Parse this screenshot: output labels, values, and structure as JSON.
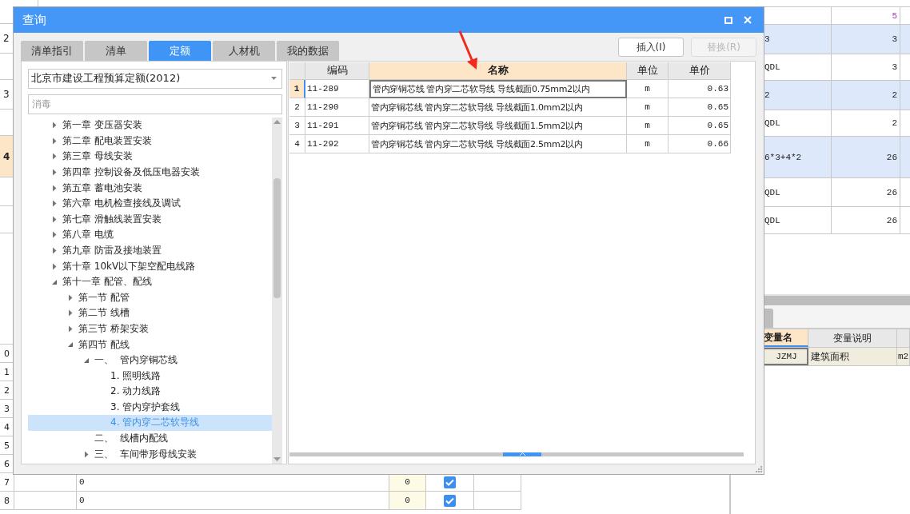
{
  "sheet": {
    "upper_rows": [
      {
        "number": "",
        "column_1": "",
        "column_2": "5",
        "highlighted": false,
        "selected": false
      },
      {
        "number": "2",
        "column_1": "3",
        "column_2": "3",
        "highlighted": true,
        "selected": false
      },
      {
        "number": "",
        "column_1": "QDL",
        "column_2": "3",
        "highlighted": false,
        "selected": false
      },
      {
        "number": "3",
        "column_1": "2",
        "column_2": "2",
        "highlighted": true,
        "selected": false
      },
      {
        "number": "",
        "column_1": "QDL",
        "column_2": "2",
        "highlighted": false,
        "selected": false
      },
      {
        "number": "4",
        "column_1": "6*3+4*2",
        "column_2": "26",
        "highlighted": true,
        "selected": true
      },
      {
        "number": "",
        "column_1": "QDL",
        "column_2": "26",
        "highlighted": false,
        "selected": false
      },
      {
        "number": "",
        "column_1": "QDL",
        "column_2": "26",
        "highlighted": false,
        "selected": false
      }
    ],
    "lower_rows": [
      {
        "number": "0"
      },
      {
        "number": "1"
      },
      {
        "number": "2"
      },
      {
        "number": "3"
      },
      {
        "number": "4"
      },
      {
        "number": "5"
      },
      {
        "number": "6"
      },
      {
        "number": "7",
        "column_1": "0",
        "column_2": "0",
        "checked": true
      },
      {
        "number": "8",
        "column_1": "0",
        "column_2": "0",
        "checked": true
      }
    ],
    "variables": {
      "columns": [
        {
          "label": "变量名",
          "selected": true
        },
        {
          "label": "变量说明",
          "selected": false
        }
      ],
      "rows": [
        [
          "JZMJ",
          "建筑面积",
          "m2"
        ]
      ]
    }
  },
  "dialog": {
    "title": "查询",
    "tabs": [
      {
        "label": "清单指引",
        "selected": false
      },
      {
        "label": "清单",
        "selected": false
      },
      {
        "label": "定额",
        "selected": true
      },
      {
        "label": "人材机",
        "selected": false
      },
      {
        "label": "我的数据",
        "selected": false
      }
    ],
    "buttons": [
      {
        "label": "插入(I)",
        "disabled": false
      },
      {
        "label": "替换(R)",
        "disabled": true
      }
    ],
    "library": {
      "value": "北京市建设工程预算定额(2012)"
    },
    "search": {
      "placeholder": "消毒"
    },
    "tree": [
      {
        "label": "第一章 变压器安装",
        "kind": "branch",
        "expanded": false,
        "selected": false
      },
      {
        "label": "第二章 配电装置安装",
        "kind": "branch",
        "expanded": false,
        "selected": false
      },
      {
        "label": "第三章 母线安装",
        "kind": "branch",
        "expanded": false,
        "selected": false
      },
      {
        "label": "第四章 控制设备及低压电器安装",
        "kind": "branch",
        "expanded": false,
        "selected": false
      },
      {
        "label": "第五章 蓄电池安装",
        "kind": "branch",
        "expanded": false,
        "selected": false
      },
      {
        "label": "第六章 电机检查接线及调试",
        "kind": "branch",
        "expanded": false,
        "selected": false
      },
      {
        "label": "第七章 滑触线装置安装",
        "kind": "branch",
        "expanded": false,
        "selected": false
      },
      {
        "label": "第八章 电缆",
        "kind": "branch",
        "expanded": false,
        "selected": false
      },
      {
        "label": "第九章 防雷及接地装置",
        "kind": "branch",
        "expanded": false,
        "selected": false
      },
      {
        "label": "第十章 10kV以下架空配电线路",
        "kind": "branch",
        "expanded": false,
        "selected": false
      },
      {
        "label": "第十一章 配管、配线",
        "kind": "branch",
        "expanded": true,
        "selected": false,
        "children": [
          {
            "label": "第一节 配管",
            "kind": "branch",
            "expanded": false,
            "selected": false
          },
          {
            "label": "第二节 线槽",
            "kind": "branch",
            "expanded": false,
            "selected": false
          },
          {
            "label": "第三节 桥架安装",
            "kind": "branch",
            "expanded": false,
            "selected": false
          },
          {
            "label": "第四节 配线",
            "kind": "branch",
            "expanded": true,
            "selected": false,
            "children": [
              {
                "label": "一、  管内穿铜芯线",
                "kind": "branch",
                "expanded": true,
                "selected": false,
                "children": [
                  {
                    "label": "1. 照明线路",
                    "kind": "leaf",
                    "selected": false
                  },
                  {
                    "label": "2. 动力线路",
                    "kind": "leaf",
                    "selected": false
                  },
                  {
                    "label": "3. 管内穿护套线",
                    "kind": "leaf",
                    "selected": false
                  },
                  {
                    "label": "4. 管内穿二芯软导线",
                    "kind": "leaf",
                    "selected": true
                  }
                ]
              },
              {
                "label": "二、  线槽内配线",
                "kind": "leaf",
                "selected": false
              },
              {
                "label": "三、  车间带形母线安装",
                "kind": "branch",
                "expanded": false,
                "selected": false
              }
            ]
          }
        ]
      }
    ],
    "table": {
      "columns": [
        {
          "label": "编码",
          "selected": false
        },
        {
          "label": "名称",
          "selected": true
        },
        {
          "label": "单位",
          "selected": false
        },
        {
          "label": "单价",
          "selected": false
        }
      ],
      "rows": [
        {
          "number": "1",
          "code": "11-289",
          "name": "管内穿铜芯线 管内穿二芯软导线 导线截面0.75mm2以内",
          "unit": "m",
          "price": "0.63",
          "selected": true
        },
        {
          "number": "2",
          "code": "11-290",
          "name": "管内穿铜芯线 管内穿二芯软导线 导线截面1.0mm2以内",
          "unit": "m",
          "price": "0.65",
          "selected": false
        },
        {
          "number": "3",
          "code": "11-291",
          "name": "管内穿铜芯线 管内穿二芯软导线 导线截面1.5mm2以内",
          "unit": "m",
          "price": "0.65",
          "selected": false
        },
        {
          "number": "4",
          "code": "11-292",
          "name": "管内穿铜芯线 管内穿二芯软导线 导线截面2.5mm2以内",
          "unit": "m",
          "price": "0.66",
          "selected": false
        }
      ]
    }
  }
}
